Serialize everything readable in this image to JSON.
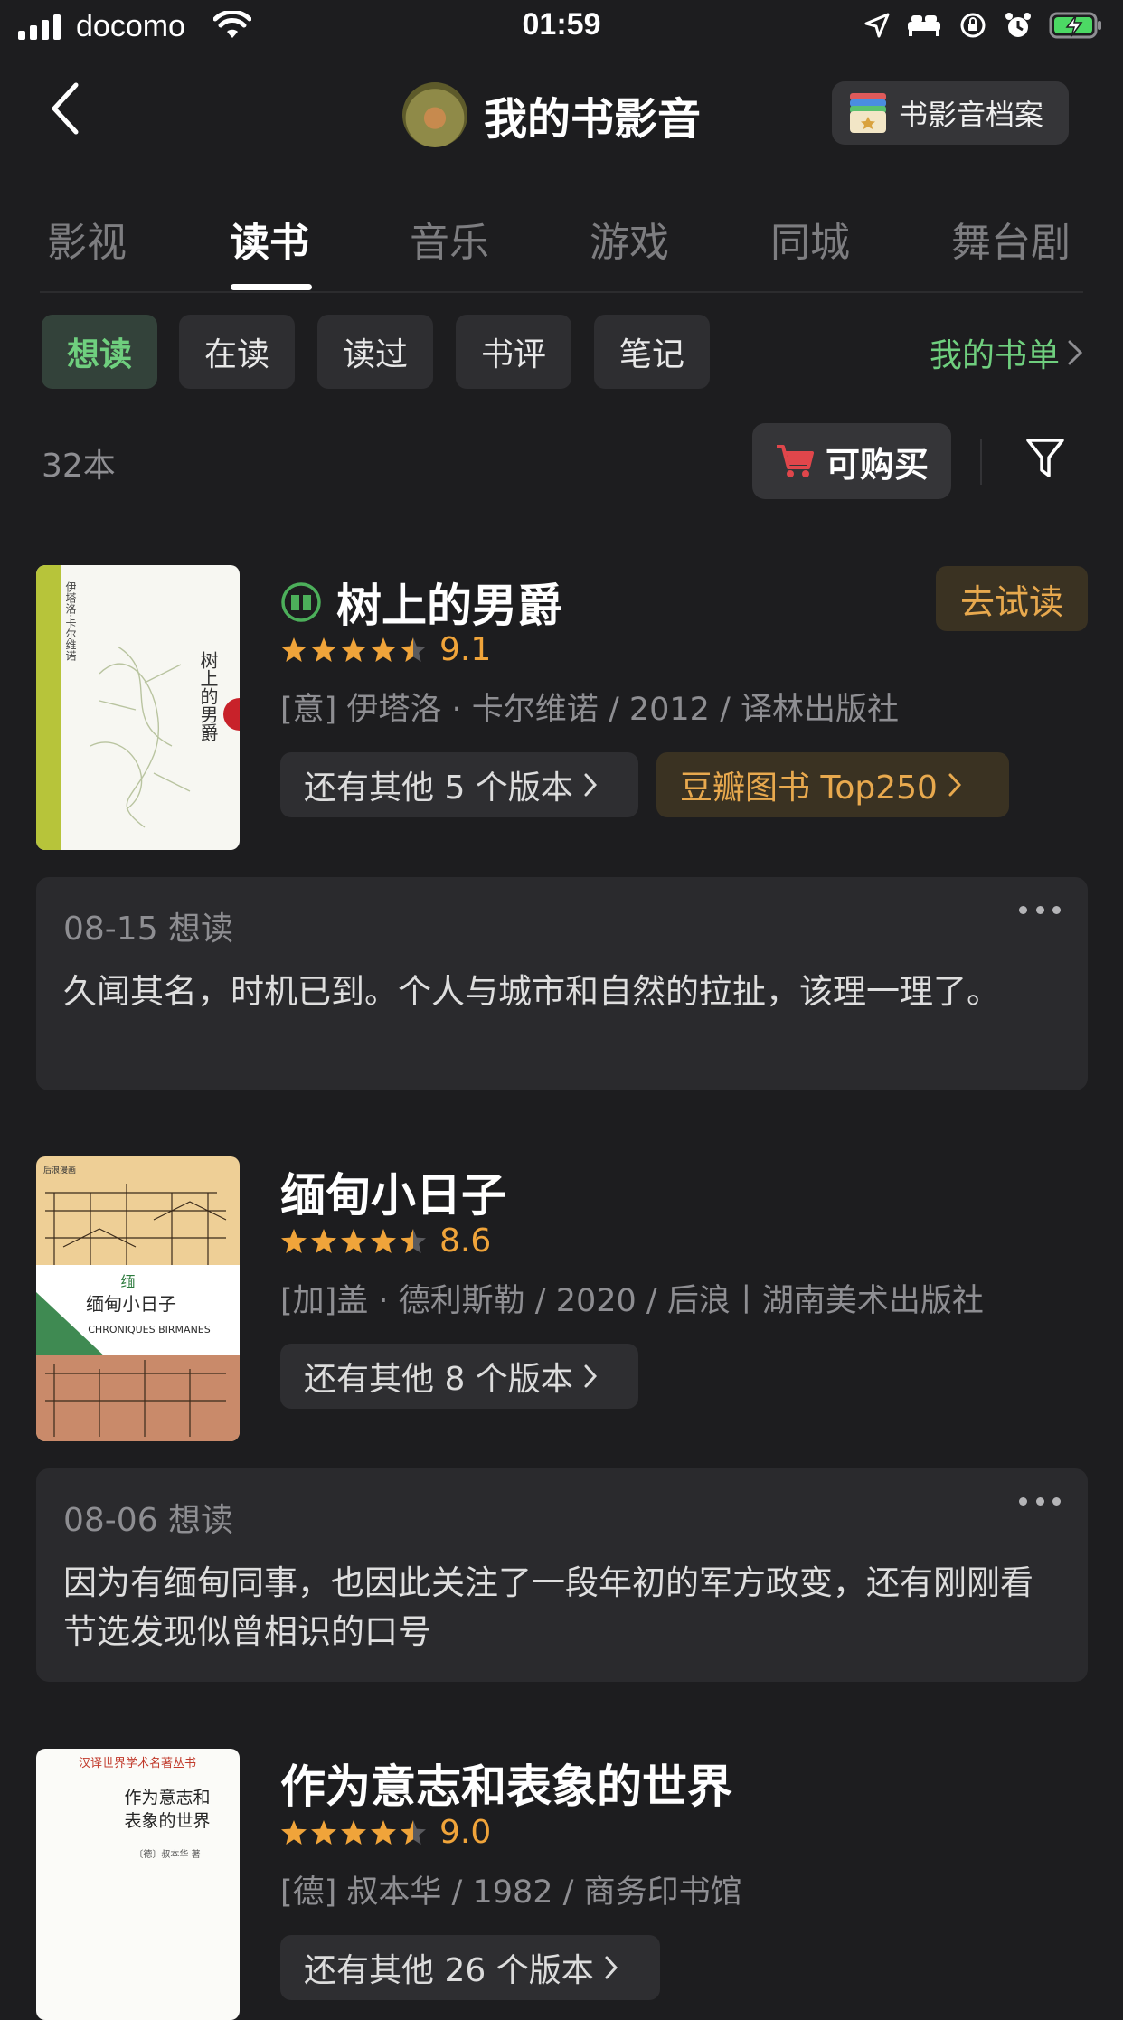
{
  "status_bar": {
    "carrier": "docomo",
    "time": "01:59"
  },
  "header": {
    "title": "我的书影音",
    "archive_label": "书影音档案"
  },
  "tabs": [
    {
      "label": "影视"
    },
    {
      "label": "读书"
    },
    {
      "label": "音乐"
    },
    {
      "label": "游戏"
    },
    {
      "label": "同城"
    },
    {
      "label": "舞台剧"
    }
  ],
  "active_tab": "读书",
  "filters": [
    {
      "label": "想读"
    },
    {
      "label": "在读"
    },
    {
      "label": "读过"
    },
    {
      "label": "书评"
    },
    {
      "label": "笔记"
    }
  ],
  "active_filter": "想读",
  "booklist_link": "我的书单",
  "count": "32本",
  "buy_label": "可购买",
  "colors": {
    "accent_green": "#6fcf7e",
    "star_orange": "#f0a43a",
    "background": "#1d1d1f"
  },
  "books": [
    {
      "title": "树上的男爵",
      "rating": 4.5,
      "score": "9.1",
      "meta": "[意] 伊塔洛 · 卡尔维诺 / 2012 / 译林出版社",
      "versions": "还有其他 5 个版本",
      "top_badge": "豆瓣图书 Top250",
      "trial": "去试读",
      "note_date": "08-15 想读",
      "note_text": "久闻其名，时机已到。个人与城市和自然的拉扯，该理一理了。"
    },
    {
      "title": "缅甸小日子",
      "rating": 4.5,
      "score": "8.6",
      "meta": "[加]盖 · 德利斯勒 / 2020 / 后浪丨湖南美术出版社",
      "versions": "还有其他 8 个版本",
      "note_date": "08-06 想读",
      "note_text": "因为有缅甸同事，也因此关注了一段年初的军方政变，还有刚刚看节选发现似曾相识的口号"
    },
    {
      "title": "作为意志和表象的世界",
      "rating": 4.5,
      "score": "9.0",
      "meta": "[德] 叔本华 / 1982 / 商务印书馆",
      "versions": "还有其他 26 个版本"
    }
  ]
}
